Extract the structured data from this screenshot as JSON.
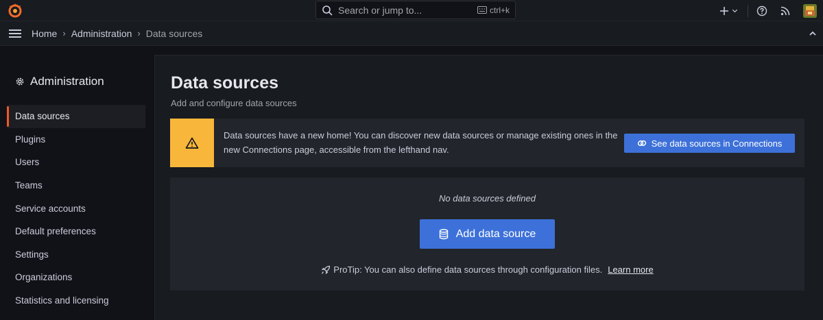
{
  "topbar": {
    "search_placeholder": "Search or jump to...",
    "search_shortcut": "ctrl+k"
  },
  "breadcrumb": {
    "items": [
      "Home",
      "Administration",
      "Data sources"
    ]
  },
  "sidebar": {
    "heading": "Administration",
    "items": [
      {
        "label": "Data sources",
        "active": true
      },
      {
        "label": "Plugins"
      },
      {
        "label": "Users"
      },
      {
        "label": "Teams"
      },
      {
        "label": "Service accounts"
      },
      {
        "label": "Default preferences"
      },
      {
        "label": "Settings"
      },
      {
        "label": "Organizations"
      },
      {
        "label": "Statistics and licensing"
      }
    ]
  },
  "page": {
    "title": "Data sources",
    "subtitle": "Add and configure data sources"
  },
  "alert": {
    "text": "Data sources have a new home! You can discover new data sources or manage existing ones in the new Connections page, accessible from the lefthand nav.",
    "button_label": "See data sources in Connections"
  },
  "empty_state": {
    "message": "No data sources defined",
    "button_label": "Add data source",
    "protip": "ProTip: You can also define data sources through configuration files.",
    "link_label": "Learn more"
  },
  "colors": {
    "primary": "#3d71d9",
    "warning": "#f8b63a",
    "active_indicator": "#f05a28"
  },
  "icons": {
    "logo": "grafana-logo-icon",
    "search": "search-icon",
    "keyboard": "keyboard-icon",
    "plus": "plus-icon",
    "help": "help-icon",
    "news": "rss-icon",
    "menu": "hamburger-icon",
    "collapse": "chevron-up-icon",
    "admin": "gear-icon",
    "warning": "warning-triangle-icon",
    "connections": "link-icon",
    "database": "database-icon",
    "rocket": "rocket-icon"
  }
}
